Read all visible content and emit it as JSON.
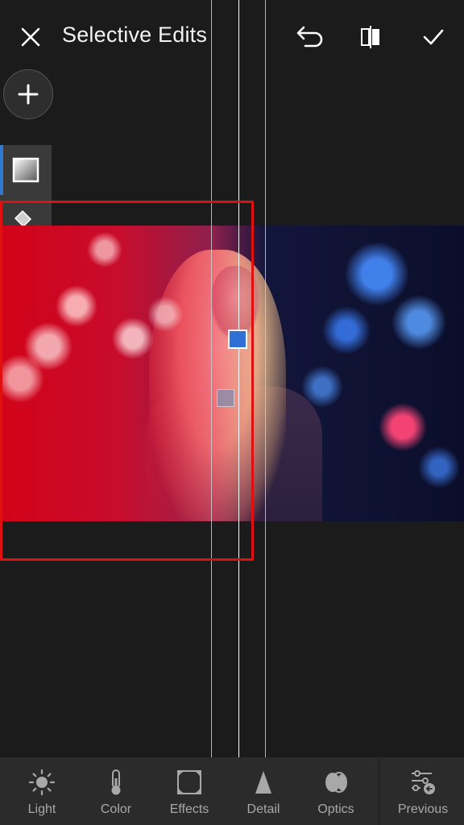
{
  "header": {
    "title": "Selective Edits"
  },
  "toolbar": {
    "items": [
      {
        "label": "Light",
        "icon": "sun-icon"
      },
      {
        "label": "Color",
        "icon": "thermometer-icon"
      },
      {
        "label": "Effects",
        "icon": "vignette-icon"
      },
      {
        "label": "Detail",
        "icon": "triangle-icon"
      },
      {
        "label": "Optics",
        "icon": "lens-icon"
      },
      {
        "label": "Previous",
        "icon": "sliders-previous-icon"
      }
    ]
  },
  "colors": {
    "accent": "#2f7bd4",
    "mask": "#e01020",
    "highlight_box": "#e01010",
    "background": "#1b1b1b"
  }
}
